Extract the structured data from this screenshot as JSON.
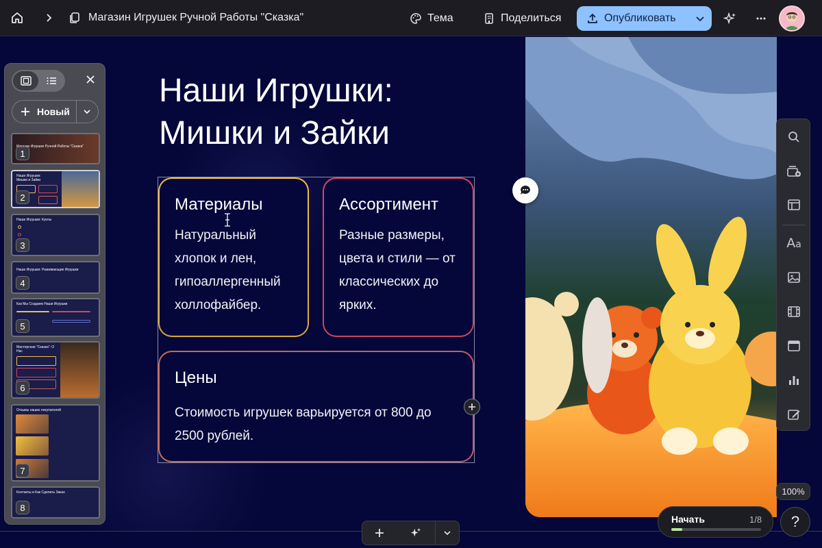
{
  "topbar": {
    "doc_title": "Магазин Игрушек Ручной Работы \"Сказка\"",
    "theme_label": "Тема",
    "share_label": "Поделиться",
    "publish_label": "Опубликовать"
  },
  "slide": {
    "title_line1": "Наши Игрушки:",
    "title_line2": "Мишки и Зайки",
    "cards": [
      {
        "heading": "Материалы",
        "text": "Натуральный хлопок и лен, гипоаллергенный холлофайбер."
      },
      {
        "heading": "Ассортимент",
        "text": "Разные размеры, цвета и стили — от классических до ярких."
      },
      {
        "heading": "Цены",
        "text": "Стоимость игрушек варьируется от 800 до 2500 рублей."
      }
    ]
  },
  "panel": {
    "new_label": "Новый",
    "thumbnails": [
      {
        "num": "1",
        "title": "Магазин Игрушек Ручной Работы \"Сказка\""
      },
      {
        "num": "2",
        "title": "Наши Игрушки: Мишки и Зайки"
      },
      {
        "num": "3",
        "title": "Наши Игрушки: Куклы"
      },
      {
        "num": "4",
        "title": "Наши Игрушки: Развивающие Игрушки"
      },
      {
        "num": "5",
        "title": "Как Мы Создаем Наши Игрушки"
      },
      {
        "num": "6",
        "title": "Мастерская \"Сказка\": О Нас"
      },
      {
        "num": "7",
        "title": "Отзывы наших покупателей"
      },
      {
        "num": "8",
        "title": "Контакты и Как Сделать Заказ"
      }
    ]
  },
  "zoom": "100%",
  "presenter": {
    "start_label": "Начать",
    "slide_counter": "1/8",
    "progress": 0.125
  },
  "help_label": "?",
  "icons": {
    "accent": "#8ec1ff",
    "card_borders": [
      "#f0c04a",
      "#d8465c",
      "#c9655c"
    ]
  }
}
